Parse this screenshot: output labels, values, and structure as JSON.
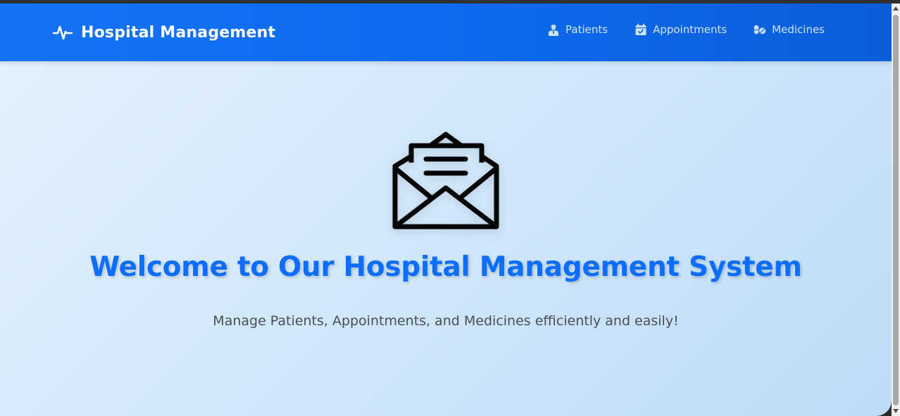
{
  "brand": {
    "title": "Hospital Management",
    "icon": "heartbeat-icon"
  },
  "nav": {
    "items": [
      {
        "label": "Patients",
        "icon": "doctor-icon"
      },
      {
        "label": "Appointments",
        "icon": "calendar-check-icon"
      },
      {
        "label": "Medicines",
        "icon": "pills-icon"
      }
    ]
  },
  "hero": {
    "icon": "open-envelope-icon",
    "title": "Welcome to Our Hospital Management System",
    "subtitle": "Manage Patients, Appointments, and Medicines efficiently and easily!"
  },
  "colors": {
    "navbar": "#0d6efd",
    "title": "#0d6efd",
    "nav_text": "#cfe2ff",
    "subtitle": "#4a4f55"
  }
}
